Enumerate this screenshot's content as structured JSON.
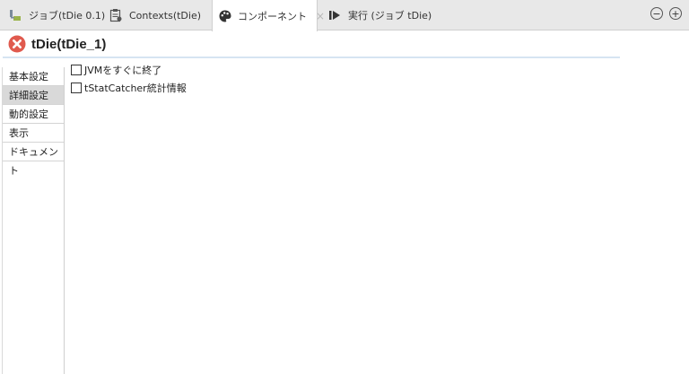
{
  "tabs": [
    {
      "label": "ジョブ(tDie 0.1)",
      "icon": "job-icon",
      "active": false
    },
    {
      "label": "Contexts(tDie)",
      "icon": "contexts-icon",
      "active": false
    },
    {
      "label": "コンポーネント",
      "icon": "palette-icon",
      "active": true,
      "close": "×"
    },
    {
      "label": "実行 (ジョブ tDie)",
      "icon": "run-icon",
      "active": false
    }
  ],
  "window_controls": {
    "minimize": "−",
    "maximize": "+"
  },
  "header": {
    "title": "tDie(tDie_1)",
    "icon": "error-icon",
    "icon_color": "#e05a4e"
  },
  "sidebar": {
    "items": [
      {
        "label": "基本設定",
        "active": false
      },
      {
        "label": "詳細設定",
        "active": true
      },
      {
        "label": "動的設定",
        "active": false
      },
      {
        "label": "表示",
        "active": false
      },
      {
        "label": "ドキュメント",
        "active": false
      }
    ]
  },
  "options": [
    {
      "label": "JVMをすぐに終了",
      "checked": false
    },
    {
      "label": "tStatCatcher統計情報",
      "checked": false
    }
  ]
}
